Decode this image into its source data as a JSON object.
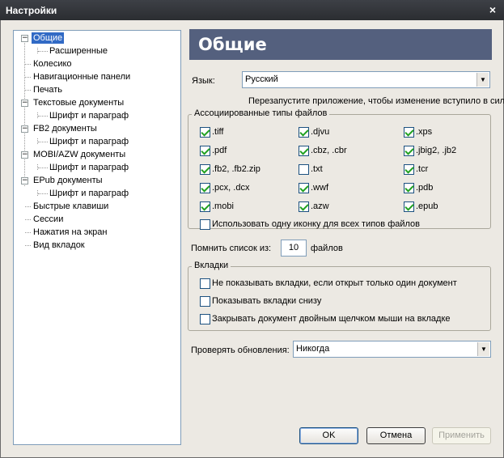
{
  "window": {
    "title": "Настройки",
    "close_glyph": "×"
  },
  "tree": {
    "items": [
      {
        "label": "Общие",
        "level": 0,
        "selected": true,
        "expander": "minus"
      },
      {
        "label": "Расширенные",
        "level": 1
      },
      {
        "label": "Колесико",
        "level": 0
      },
      {
        "label": "Навигационные панели",
        "level": 0
      },
      {
        "label": "Печать",
        "level": 0
      },
      {
        "label": "Текстовые документы",
        "level": 0,
        "expander": "minus"
      },
      {
        "label": "Шрифт и параграф",
        "level": 1
      },
      {
        "label": "FB2 документы",
        "level": 0,
        "expander": "minus"
      },
      {
        "label": "Шрифт и параграф",
        "level": 1
      },
      {
        "label": "MOBI/AZW документы",
        "level": 0,
        "expander": "minus"
      },
      {
        "label": "Шрифт и параграф",
        "level": 1
      },
      {
        "label": "EPub документы",
        "level": 0,
        "expander": "minus"
      },
      {
        "label": "Шрифт и параграф",
        "level": 1
      },
      {
        "label": "Быстрые клавиши",
        "level": 0
      },
      {
        "label": "Сессии",
        "level": 0
      },
      {
        "label": "Нажатия на экран",
        "level": 0
      },
      {
        "label": "Вид вкладок",
        "level": 0
      }
    ]
  },
  "page": {
    "header": "Общие",
    "language_label": "Язык:",
    "language_value": "Русский",
    "restart_note": "Перезапустите приложение, чтобы изменение вступило в силу.",
    "assoc_group": {
      "legend": "Ассоциированные типы файлов",
      "types": [
        {
          "label": ".tiff",
          "checked": true
        },
        {
          "label": ".djvu",
          "checked": true
        },
        {
          "label": ".xps",
          "checked": true
        },
        {
          "label": ".pdf",
          "checked": true
        },
        {
          "label": ".cbz, .cbr",
          "checked": true
        },
        {
          "label": ".jbig2, .jb2",
          "checked": true
        },
        {
          "label": ".fb2, .fb2.zip",
          "checked": true
        },
        {
          "label": ".txt",
          "checked": false
        },
        {
          "label": ".tcr",
          "checked": true
        },
        {
          "label": ".pcx, .dcx",
          "checked": true
        },
        {
          "label": ".wwf",
          "checked": true
        },
        {
          "label": ".pdb",
          "checked": true
        },
        {
          "label": ".mobi",
          "checked": true
        },
        {
          "label": ".azw",
          "checked": true
        },
        {
          "label": ".epub",
          "checked": true
        }
      ],
      "single_icon": {
        "label": "Использовать одну иконку для всех типов файлов",
        "checked": false
      }
    },
    "recent": {
      "prefix": "Помнить список из:",
      "value": "10",
      "suffix": "файлов"
    },
    "tabs_group": {
      "legend": "Вкладки",
      "options": [
        {
          "label": "Не показывать вкладки, если открыт только один документ",
          "checked": false
        },
        {
          "label": "Показывать вкладки снизу",
          "checked": false
        },
        {
          "label": "Закрывать документ двойным щелчком мыши на вкладке",
          "checked": false
        }
      ]
    },
    "updates_label": "Проверять обновления:",
    "updates_value": "Никогда"
  },
  "buttons": {
    "ok": "OK",
    "cancel": "Отмена",
    "apply": "Применить"
  },
  "icons": {
    "dropdown": "chevron-down-icon",
    "close": "close-icon",
    "collapse": "minus-icon"
  }
}
